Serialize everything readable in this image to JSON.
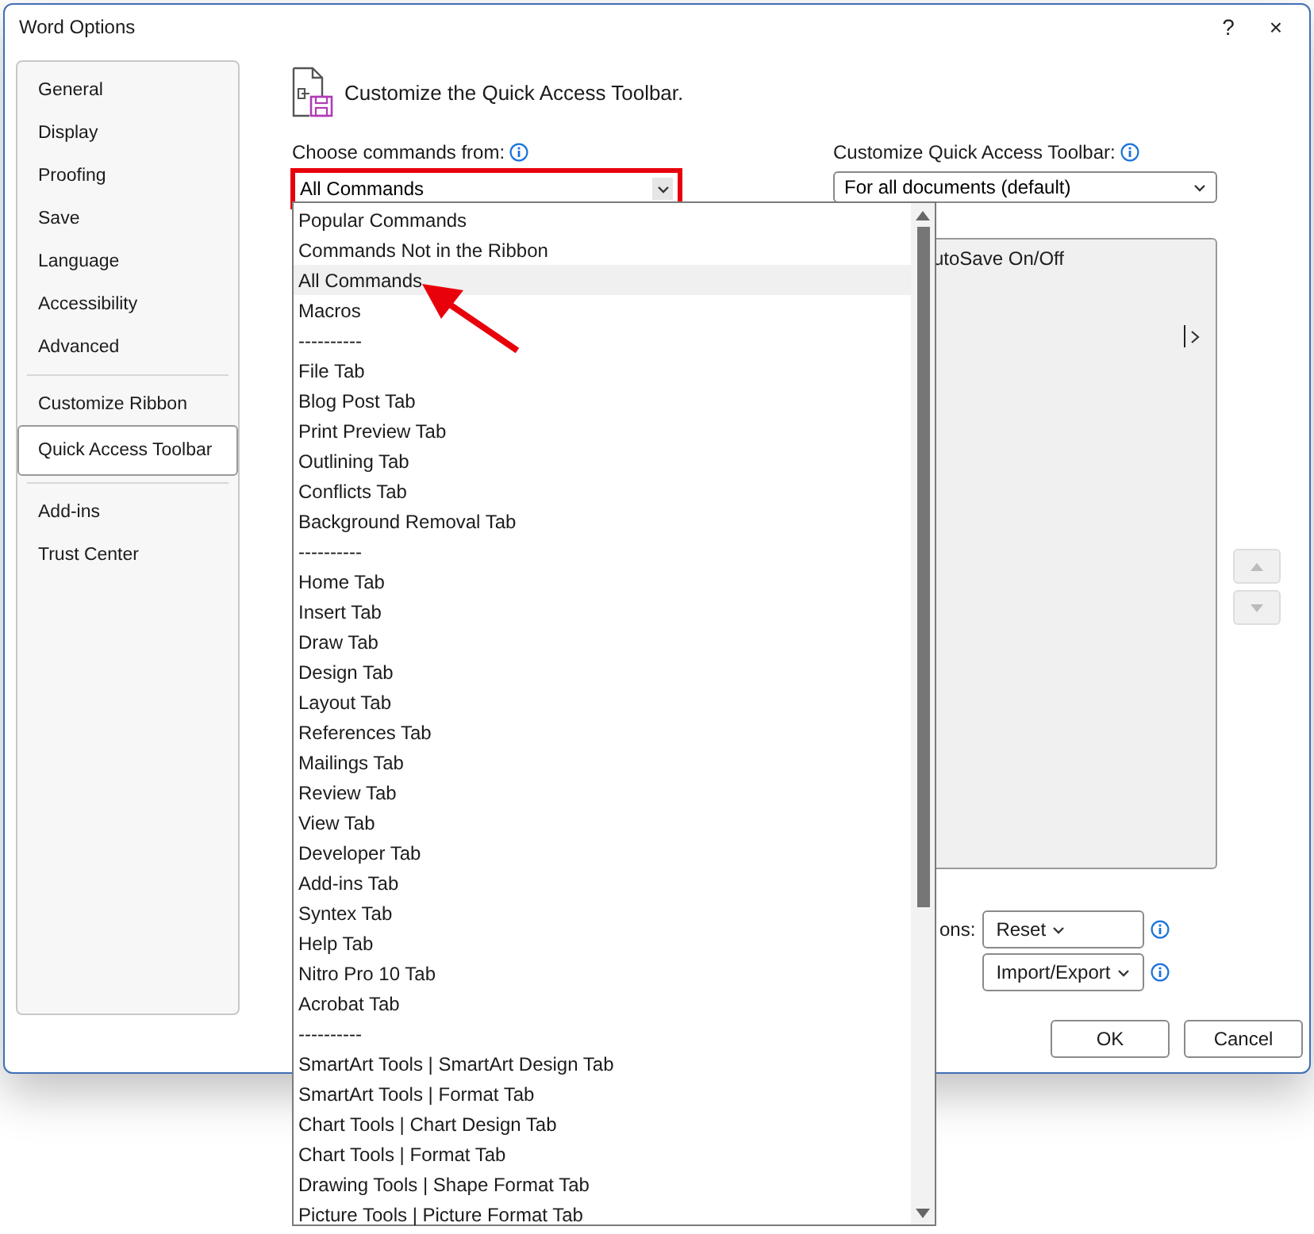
{
  "window": {
    "title": "Word Options",
    "help": "?",
    "close": "×"
  },
  "sidebar": {
    "groups": [
      [
        {
          "label": "General",
          "selected": false
        },
        {
          "label": "Display",
          "selected": false
        },
        {
          "label": "Proofing",
          "selected": false
        },
        {
          "label": "Save",
          "selected": false
        },
        {
          "label": "Language",
          "selected": false
        },
        {
          "label": "Accessibility",
          "selected": false
        },
        {
          "label": "Advanced",
          "selected": false
        }
      ],
      [
        {
          "label": "Customize Ribbon",
          "selected": false
        },
        {
          "label": "Quick Access Toolbar",
          "selected": true
        }
      ],
      [
        {
          "label": "Add-ins",
          "selected": false
        },
        {
          "label": "Trust Center",
          "selected": false
        }
      ]
    ]
  },
  "header": {
    "title": "Customize the Quick Access Toolbar."
  },
  "choose_commands": {
    "label": "Choose commands from:",
    "value": "All Commands",
    "options": [
      {
        "label": "Popular Commands",
        "selected": false
      },
      {
        "label": "Commands Not in the Ribbon",
        "selected": false
      },
      {
        "label": "All Commands",
        "selected": true
      },
      {
        "label": "Macros",
        "selected": false
      },
      {
        "label": "----------",
        "selected": false
      },
      {
        "label": "File Tab",
        "selected": false
      },
      {
        "label": "Blog Post Tab",
        "selected": false
      },
      {
        "label": "Print Preview Tab",
        "selected": false
      },
      {
        "label": "Outlining Tab",
        "selected": false
      },
      {
        "label": "Conflicts Tab",
        "selected": false
      },
      {
        "label": "Background Removal Tab",
        "selected": false
      },
      {
        "label": "----------",
        "selected": false
      },
      {
        "label": "Home Tab",
        "selected": false
      },
      {
        "label": "Insert Tab",
        "selected": false
      },
      {
        "label": "Draw Tab",
        "selected": false
      },
      {
        "label": "Design Tab",
        "selected": false
      },
      {
        "label": "Layout Tab",
        "selected": false
      },
      {
        "label": "References Tab",
        "selected": false
      },
      {
        "label": "Mailings Tab",
        "selected": false
      },
      {
        "label": "Review Tab",
        "selected": false
      },
      {
        "label": "View Tab",
        "selected": false
      },
      {
        "label": "Developer Tab",
        "selected": false
      },
      {
        "label": "Add-ins Tab",
        "selected": false
      },
      {
        "label": "Syntex Tab",
        "selected": false
      },
      {
        "label": "Help Tab",
        "selected": false
      },
      {
        "label": "Nitro Pro 10 Tab",
        "selected": false
      },
      {
        "label": "Acrobat Tab",
        "selected": false
      },
      {
        "label": "----------",
        "selected": false
      },
      {
        "label": "SmartArt Tools | SmartArt Design Tab",
        "selected": false
      },
      {
        "label": "SmartArt Tools | Format Tab",
        "selected": false
      },
      {
        "label": "Chart Tools | Chart Design Tab",
        "selected": false
      },
      {
        "label": "Chart Tools | Format Tab",
        "selected": false
      },
      {
        "label": "Drawing Tools | Shape Format Tab",
        "selected": false
      },
      {
        "label": "Picture Tools | Picture Format Tab",
        "selected": false
      }
    ]
  },
  "customize_toolbar": {
    "label": "Customize Quick Access Toolbar:",
    "value": "For all documents (default)",
    "items": [
      "utoSave On/Off"
    ]
  },
  "customizations": {
    "label": "ons:",
    "buttons": [
      "Reset",
      "Import/Export"
    ]
  },
  "footer_buttons": [
    "OK",
    "Cancel"
  ]
}
